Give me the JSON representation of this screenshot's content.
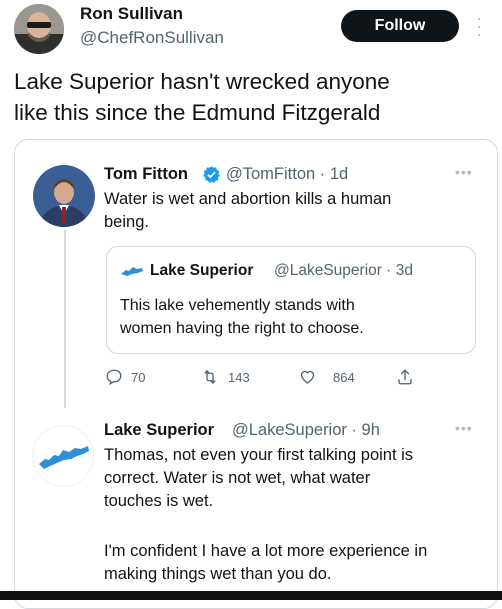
{
  "outer_tweet": {
    "display_name": "Ron Sullivan",
    "handle": "@ChefRonSullivan",
    "follow_label": "Follow",
    "text_line1": "Lake Superior hasn't wrecked anyone",
    "text_line2": "like this since the Edmund Fitzgerald"
  },
  "tweet1": {
    "display_name": "Tom Fitton",
    "handle_time": "@TomFitton · 1d",
    "text_line1": "Water is wet and abortion kills a human",
    "text_line2": "being.",
    "quote": {
      "display_name": "Lake Superior",
      "handle_time": "@LakeSuperior · 3d",
      "text_line1": "This lake vehemently stands with",
      "text_line2": "women having the right to choose."
    },
    "actions": {
      "reply_count": "70",
      "retweet_count": "143",
      "like_count": "864"
    }
  },
  "tweet2": {
    "display_name": "Lake Superior",
    "handle_time": "@LakeSuperior · 9h",
    "text_line1": "Thomas, not even your first talking point is",
    "text_line2": "correct. Water is not wet, what water",
    "text_line3": "touches is wet.",
    "text_line4": "I'm confident I have a lot more experience in",
    "text_line5": "making things wet than you do."
  },
  "colors": {
    "verified": "#1d9bf0",
    "lake_blue": "#2f8fd6",
    "muted": "#536471",
    "border": "#cfd9de"
  }
}
